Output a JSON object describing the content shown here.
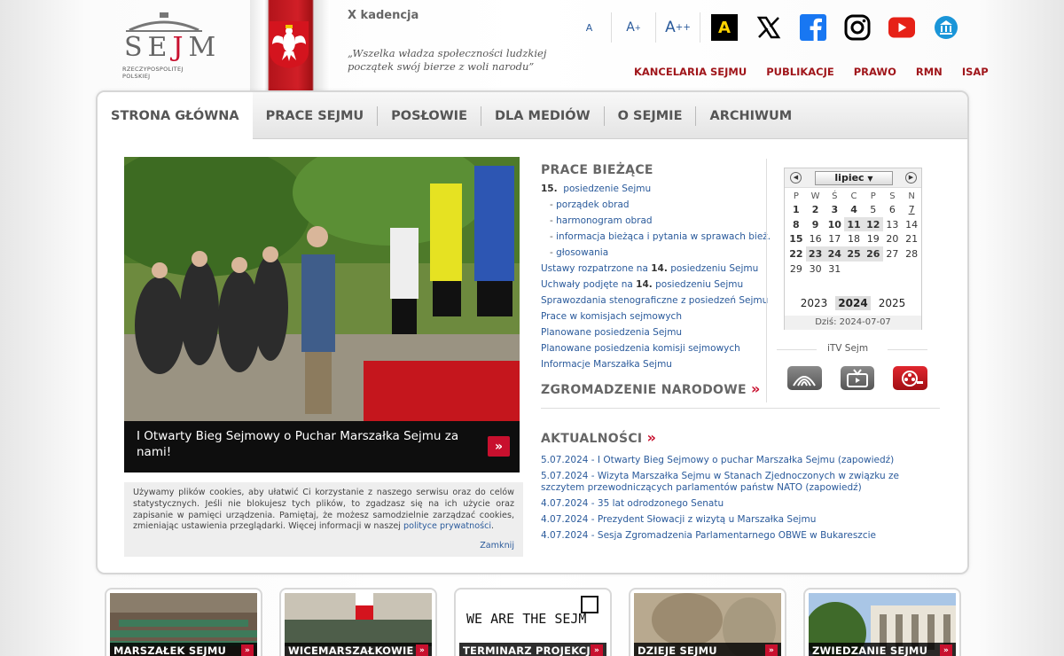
{
  "header": {
    "logo_brand": "SEJM",
    "logo_sub": "RZECZYPOSPOLITEJ POLSKIEJ",
    "term": "X kadencja",
    "quote_line1": "„Wszelka władza społeczności ludzkiej",
    "quote_line2": "początek swój bierze z woli narodu”",
    "font_small": "A",
    "font_medium": "A",
    "font_large": "A",
    "contrast_label": "A",
    "social_icons": [
      "x-icon",
      "facebook-icon",
      "instagram-icon",
      "youtube-icon",
      "museum-icon"
    ],
    "topnav": [
      "KANCELARIA SEJMU",
      "PUBLIKACJE",
      "PRAWO",
      "RMN",
      "ISAP"
    ]
  },
  "mainnav": [
    "STRONA GŁÓWNA",
    "PRACE SEJMU",
    "POSŁOWIE",
    "DLA MEDIÓW",
    "O SEJMIE",
    "ARCHIWUM"
  ],
  "hero": {
    "caption": "I Otwarty Bieg Sejmowy o Puchar Marszałka Sejmu za nami!",
    "more": "»"
  },
  "cookie": {
    "text": "Używamy plików cookies, aby ułatwić Ci korzystanie z naszego serwisu oraz do celów statystycznych. Jeśli nie blokujesz tych plików, to zgadzasz się na ich użycie oraz zapisanie w pamięci urządzenia. Pamiętaj, że możesz samodzielnie zarządzać cookies, zmieniając ustawienia przeglądarki. Więcej informacji w naszej",
    "link": "polityce prywatności",
    "dot": ".",
    "close": "Zamknij"
  },
  "works": {
    "title": "PRACE BIEŻĄCE",
    "session_num": "15.",
    "session_label": "posiedzenie Sejmu",
    "sub": [
      "porządek obrad",
      "harmonogram obrad",
      "informacja bieżąca i pytania w sprawach bież.",
      "głosowania"
    ],
    "ustawy_a": "Ustawy rozpatrzone na",
    "ustawy_num": "14.",
    "ustawy_b": "posiedzeniu Sejmu",
    "uchwaly_a": "Uchwały podjęte na",
    "uchwaly_num": "14.",
    "uchwaly_b": "posiedzeniu Sejmu",
    "links": [
      "Sprawozdania stenograficzne z posiedzeń Sejmu",
      "Prace w komisjach sejmowych",
      "Planowane posiedzenia Sejmu",
      "Planowane posiedzenia komisji sejmowych",
      "Informacje Marszałka Sejmu"
    ],
    "zgrom": "ZGROMADZENIE NARODOWE",
    "arrow": "»"
  },
  "calendar": {
    "month": "lipiec",
    "days": [
      "P",
      "W",
      "Ś",
      "C",
      "P",
      "S",
      "N"
    ],
    "weeks": [
      [
        "1",
        "2",
        "3",
        "4",
        "5",
        "6",
        "7"
      ],
      [
        "8",
        "9",
        "10",
        "11",
        "12",
        "13",
        "14"
      ],
      [
        "15",
        "16",
        "17",
        "18",
        "19",
        "20",
        "21"
      ],
      [
        "22",
        "23",
        "24",
        "25",
        "26",
        "27",
        "28"
      ],
      [
        "29",
        "30",
        "31",
        "",
        "",
        "",
        ""
      ]
    ],
    "bold_days": [
      "1",
      "2",
      "3",
      "4",
      "8",
      "9",
      "10",
      "11",
      "12",
      "15",
      "22",
      "23",
      "24",
      "25",
      "26"
    ],
    "highlight_days": [
      "11",
      "12",
      "23",
      "24",
      "25",
      "26"
    ],
    "underline_days": [
      "7"
    ],
    "years": [
      "2023",
      "2024",
      "2025"
    ],
    "current_year": "2024",
    "today": "Dziś: 2024-07-07"
  },
  "itv": {
    "title": "iTV Sejm",
    "buttons": [
      "broadcast-icon",
      "tv-icon",
      "film-reel-icon"
    ]
  },
  "news": {
    "title": "AKTUALNOŚCI",
    "arrow": "»",
    "items": [
      "5.07.2024 - I Otwarty Bieg Sejmowy o puchar Marszałka Sejmu (zapowiedź)",
      "5.07.2024 - Wizyta Marszałka Sejmu w Stanach Zjednoczonych w związku ze szczytem przewodniczących parlamentów państw NATO (zapowiedź)",
      "4.07.2024 - 35 lat odrodzonego Senatu",
      "4.07.2024 - Prezydent Słowacji z wizytą u Marszałka Sejmu",
      "4.07.2024 - Sesja Zgromadzenia Parlamentarnego OBWE w Bukareszcie"
    ]
  },
  "tiles": [
    "MARSZAŁEK SEJMU",
    "WICEMARSZAŁKOWIE",
    "TERMINARZ PROJEKCJI",
    "DZIEJE SEJMU",
    "ZWIEDZANIE SEJMU"
  ],
  "tile_graphic_text": "WE ARE THE SEJM",
  "colors": {
    "accent_red": "#c8102e",
    "link_blue": "#2a5a9b",
    "dark_red_nav": "#a0161b"
  }
}
